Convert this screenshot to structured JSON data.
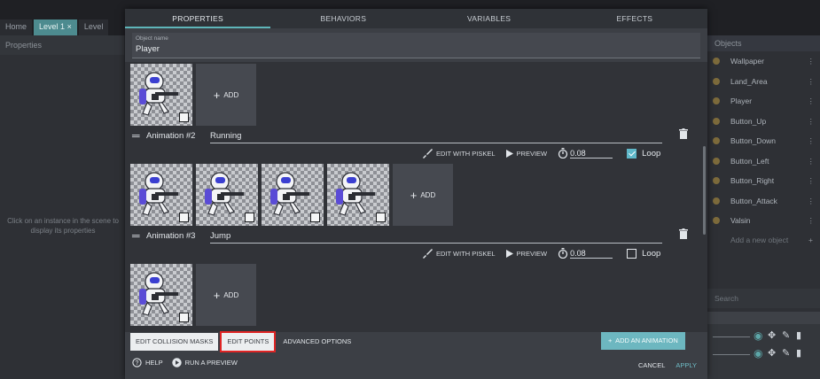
{
  "background": {
    "tabs": [
      "Home",
      "Level 1",
      "Level"
    ],
    "active_tab_close": "×",
    "left_panel_title": "Properties",
    "left_panel_hint": "Click on an instance in the scene to display its properties",
    "right_panel_title": "Objects",
    "objects": [
      "Wallpaper",
      "Land_Area",
      "Player",
      "Button_Up",
      "Button_Down",
      "Button_Left",
      "Button_Right",
      "Button_Attack",
      "Valsin"
    ],
    "add_new_object": "Add a new object",
    "search_placeholder": "Search"
  },
  "dialog": {
    "tabs": [
      "PROPERTIES",
      "BEHAVIORS",
      "VARIABLES",
      "EFFECTS"
    ],
    "active_tab": "PROPERTIES",
    "object_name_label": "Object name",
    "object_name_value": "Player",
    "add_label": "ADD",
    "animations": [
      {
        "title": "Animation #2",
        "name": "Running",
        "frames": 4,
        "speed": "0.08",
        "loop": true
      },
      {
        "title": "Animation #3",
        "name": "Jump",
        "frames": 1,
        "speed": "0.08",
        "loop": false
      }
    ],
    "first_anim_frames": 1,
    "edit_with_piskel": "EDIT WITH PISKEL",
    "preview": "PREVIEW",
    "loop_label": "Loop",
    "buttons": {
      "edit_collision_masks": "EDIT COLLISION MASKS",
      "edit_points": "EDIT POINTS",
      "advanced_options": "ADVANCED OPTIONS",
      "add_animation": "ADD AN ANIMATION"
    },
    "footer": {
      "help": "HELP",
      "run_preview": "RUN A PREVIEW",
      "cancel": "CANCEL",
      "apply": "APPLY"
    }
  },
  "colors": {
    "accent": "#5eb5b9",
    "highlight_box": "#e02424",
    "primary_button": "#6db7c0"
  }
}
